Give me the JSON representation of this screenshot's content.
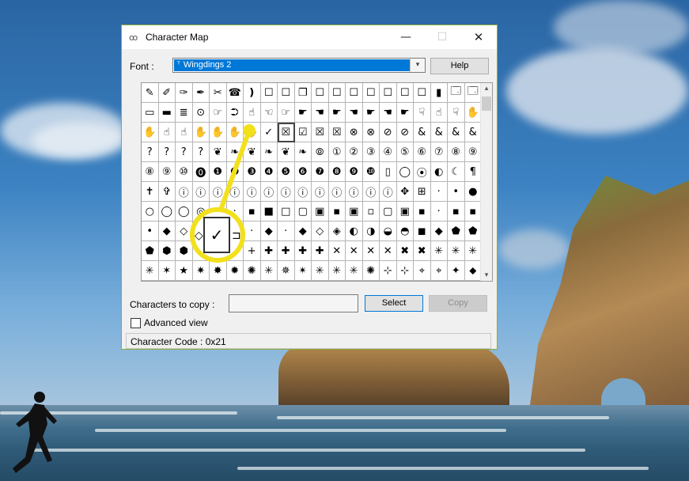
{
  "window": {
    "title": "Character Map",
    "app_icon": "ꝏ",
    "minimize_glyph": "—",
    "maximize_glyph": "☐",
    "close_glyph": "✕"
  },
  "font": {
    "label": "Font :",
    "selected": "Wingdings 2",
    "selected_glyph": "ᵀ",
    "dropdown_glyph": "▾",
    "help_label": "Help"
  },
  "grid": {
    "selected_index": 48,
    "scroll_up": "▴",
    "scroll_down": "▾",
    "rows": [
      [
        "✎",
        "✐",
        "✑",
        "✒",
        "✂",
        "☎",
        "❫",
        "☐",
        "☐",
        "❐",
        "☐",
        "☐",
        "☐",
        "☐",
        "☐",
        "☐",
        "☐",
        "▮",
        "🗔",
        "🗔"
      ],
      [
        "▭",
        "▬",
        "≣",
        "⊙",
        "☞",
        "⮊",
        "☝",
        "☜",
        "☞",
        "☛",
        "☚",
        "☛",
        "☚",
        "☛",
        "☚",
        "☛",
        "☟",
        "☝",
        "☟",
        "✋"
      ],
      [
        "✋",
        "☝",
        "☝",
        "✋",
        "✋",
        "✋",
        "✋",
        "✓",
        "☒",
        "☑",
        "☒",
        "☒",
        "⊗",
        "⊗",
        "⊘",
        "⊘",
        "&",
        "&",
        "&",
        "&"
      ],
      [
        "?",
        "?",
        "?",
        "?",
        "❦",
        "❧",
        "❦",
        "❧",
        "❦",
        "❧",
        "⦾",
        "①",
        "②",
        "③",
        "④",
        "⑤",
        "⑥",
        "⑦",
        "⑧",
        "⑨"
      ],
      [
        "⑧",
        "⑨",
        "⑩",
        "⓿",
        "❶",
        "❷",
        "❸",
        "❹",
        "❺",
        "❻",
        "❼",
        "❽",
        "❾",
        "❿",
        "▯",
        "◯",
        "⦿",
        "◐",
        "☾",
        "¶"
      ],
      [
        "✝",
        "✞",
        "ⓘ",
        "ⓘ",
        "ⓘ",
        "ⓘ",
        "ⓘ",
        "ⓘ",
        "ⓘ",
        "ⓘ",
        "ⓘ",
        "ⓘ",
        "ⓘ",
        "ⓘ",
        "ⓘ",
        "✥",
        "⊞",
        "·",
        "•",
        "●"
      ],
      [
        "○",
        "◯",
        "◯",
        "◎",
        "◉",
        "·",
        "▪",
        "■",
        "□",
        "▢",
        "▣",
        "▪",
        "▣",
        "▫",
        "▢",
        "▣",
        "▪",
        "·",
        "▪",
        "▪"
      ],
      [
        "•",
        "◆",
        "◇",
        "✓",
        "⏍",
        "⌖",
        "·",
        "◆",
        "·",
        "◆",
        "◇",
        "◈",
        "◐",
        "◑",
        "◒",
        "◓",
        "◼",
        "◆",
        "⬟",
        "⬟"
      ],
      [
        "⬟",
        "⬢",
        "⬢",
        "⬡",
        "⬡",
        "+",
        "+",
        "✚",
        "✚",
        "✚",
        "✚",
        "✕",
        "✕",
        "✕",
        "✕",
        "✖",
        "✖",
        "✳",
        "✳",
        "✳"
      ],
      [
        "✳",
        "✶",
        "★",
        "✷",
        "✸",
        "✹",
        "✺",
        "✳",
        "✵",
        "✴",
        "✳",
        "✳",
        "✳",
        "✺",
        "⊹",
        "⊹",
        "⌖",
        "⌖",
        "✦",
        "⬥"
      ]
    ]
  },
  "copy": {
    "label": "Characters to copy :",
    "value": "",
    "select_label": "Select",
    "copy_label": "Copy"
  },
  "advanced": {
    "label": "Advanced view"
  },
  "status": {
    "text": "Character Code : 0x21"
  },
  "annotation": {
    "magnified_glyph": "✓",
    "left_neighbor": "◇",
    "right_neighbor": "⊐",
    "highlight_color": "#f2e01c"
  }
}
